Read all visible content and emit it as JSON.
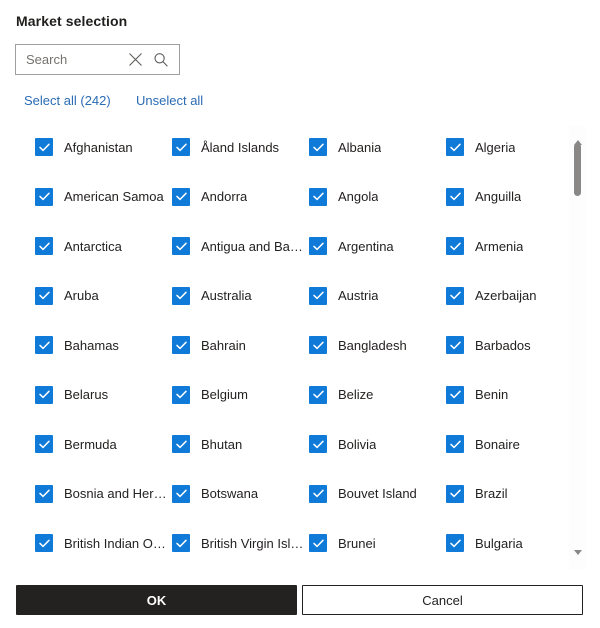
{
  "dialog": {
    "title": "Market selection"
  },
  "search": {
    "value": "",
    "placeholder": "Search",
    "clear_icon": "close-icon",
    "search_icon": "search-icon"
  },
  "actions": {
    "select_all_label": "Select all (242)",
    "unselect_all_label": "Unselect all",
    "total_count": 242
  },
  "colors": {
    "accent": "#0f7ad8",
    "link": "#2b6cb4",
    "primary_button_bg": "#242221",
    "text": "#242221",
    "border": "#a19f9d",
    "scrollbar_thumb": "#8a8886"
  },
  "list": {
    "columns": 4,
    "all_checked": true,
    "rows": [
      [
        "Afghanistan",
        "Åland Islands",
        "Albania",
        "Algeria"
      ],
      [
        "American Samoa",
        "Andorra",
        "Angola",
        "Anguilla"
      ],
      [
        "Antarctica",
        "Antigua and Bar...",
        "Argentina",
        "Armenia"
      ],
      [
        "Aruba",
        "Australia",
        "Austria",
        "Azerbaijan"
      ],
      [
        "Bahamas",
        "Bahrain",
        "Bangladesh",
        "Barbados"
      ],
      [
        "Belarus",
        "Belgium",
        "Belize",
        "Benin"
      ],
      [
        "Bermuda",
        "Bhutan",
        "Bolivia",
        "Bonaire"
      ],
      [
        "Bosnia and Herz...",
        "Botswana",
        "Bouvet Island",
        "Brazil"
      ],
      [
        "British Indian Oc...",
        "British Virgin Isla...",
        "Brunei",
        "Bulgaria"
      ]
    ]
  },
  "scrollbar": {
    "up_arrow_icon": "caret-up-icon",
    "down_arrow_icon": "caret-down-icon",
    "thumb_position_percent": 0,
    "thumb_size_percent": 13
  },
  "footer": {
    "ok_label": "OK",
    "cancel_label": "Cancel"
  }
}
